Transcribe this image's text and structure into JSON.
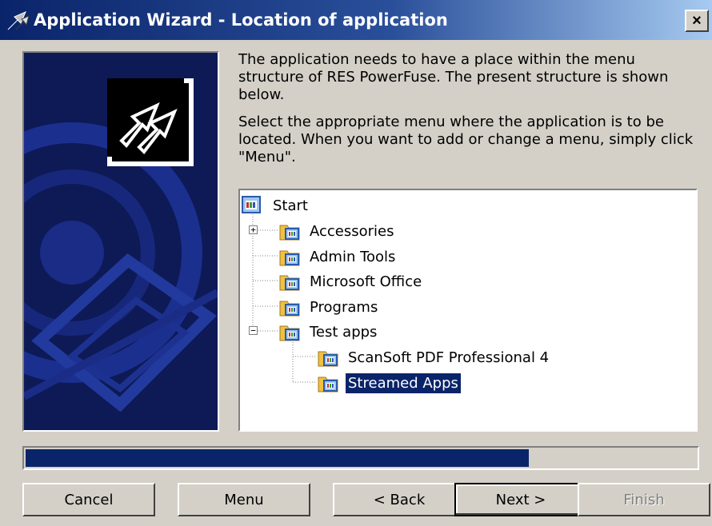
{
  "window": {
    "title": "Application Wizard - Location of application",
    "close_label": "×"
  },
  "instructions": {
    "paragraph1": "The application needs to have a place within the menu structure of RES PowerFuse. The present structure is shown below.",
    "paragraph2": "Select the appropriate menu where the application is to be located. When you want to add or change a menu, simply click \"Menu\"."
  },
  "tree": {
    "root": "Start",
    "items": [
      {
        "label": "Accessories",
        "expander": "+"
      },
      {
        "label": "Admin Tools"
      },
      {
        "label": "Microsoft Office"
      },
      {
        "label": "Programs"
      },
      {
        "label": "Test apps",
        "expander": "−"
      },
      {
        "label": "ScanSoft PDF Professional 4"
      },
      {
        "label": "Streamed Apps",
        "selected": true
      }
    ]
  },
  "progress": {
    "value_percent": 75
  },
  "buttons": {
    "cancel": "Cancel",
    "menu": "Menu",
    "back": "< Back",
    "next": "Next >",
    "finish": "Finish"
  },
  "colors": {
    "title_active": "#0a246a",
    "selection": "#0a246a",
    "face": "#d4d0c8",
    "side_panel": "#0d1a56"
  },
  "icons": {
    "title": "wizard-icon",
    "side": "wizard-arrows-icon",
    "root": "menu-root-icon",
    "folder": "menu-folder-icon"
  }
}
